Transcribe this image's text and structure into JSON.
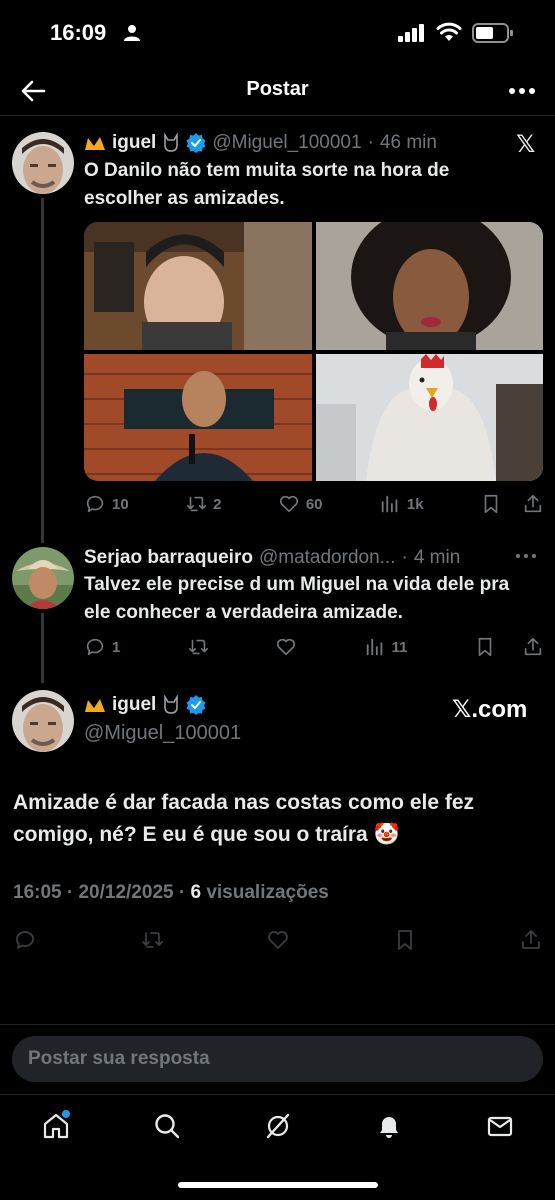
{
  "status_bar": {
    "time": "16:09"
  },
  "header": {
    "title": "Postar"
  },
  "thread": {
    "parent": {
      "display_name": "iguel",
      "handle": "@Miguel_100001",
      "separator": "·",
      "time": "46 min",
      "text": "O Danilo não tem muita sorte na hora de escolher as amizades.",
      "stats": {
        "replies": "10",
        "reposts": "2",
        "likes": "60",
        "views": "1k"
      }
    },
    "reply": {
      "display_name": "Serjao barraqueiro",
      "handle": "@matadordon...",
      "separator": "·",
      "time": "4 min",
      "text": "Talvez ele precise d um Miguel na vida dele pra ele conhecer a verdadeira amizade.",
      "stats": {
        "replies": "1",
        "views": "11"
      }
    },
    "main": {
      "display_name": "iguel",
      "handle": "@Miguel_100001",
      "watermark": "𝕏.com",
      "text": "Amizade é dar facada nas costas como ele fez comigo, né? E eu é que sou o traíra 🤡",
      "timestamp": "16:05 · 20/12/2025 · ",
      "views_count": "6",
      "views_label": " visualizações"
    }
  },
  "composer": {
    "placeholder": "Postar sua resposta"
  },
  "colors": {
    "background": "#000000",
    "text": "#e7e9ea",
    "muted": "#71767b",
    "accent": "#1d9bf0"
  },
  "icons": {
    "x_logo": "𝕏"
  }
}
